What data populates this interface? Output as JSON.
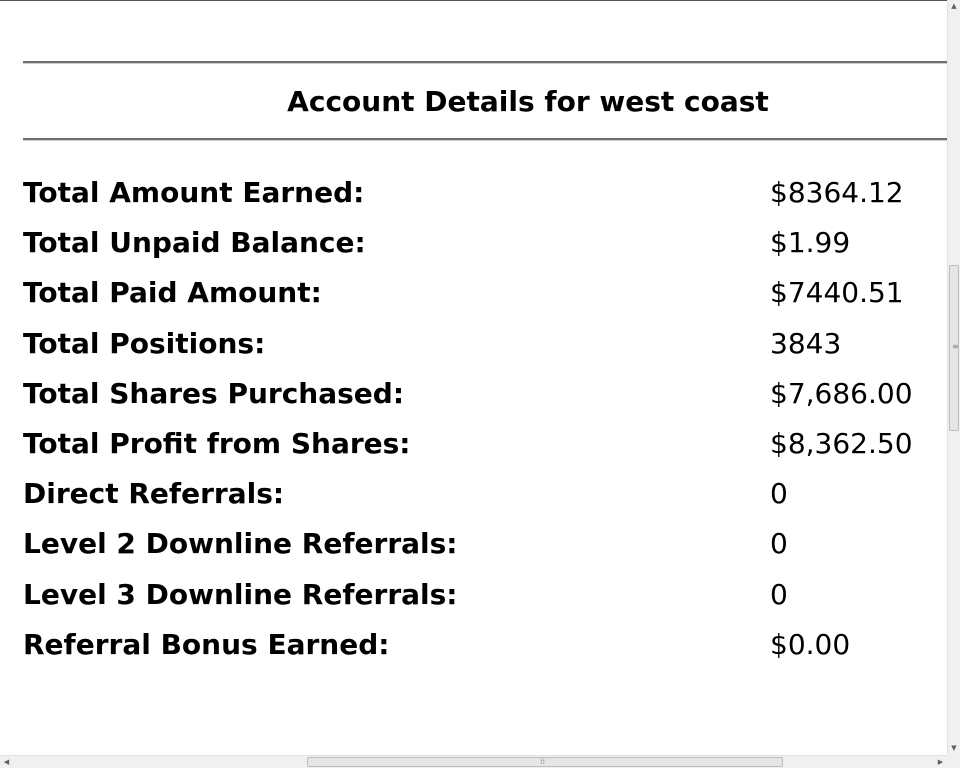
{
  "page": {
    "title": "Account Details for west coast"
  },
  "details": [
    {
      "label": "Total Amount Earned:",
      "value": "$8364.12"
    },
    {
      "label": "Total Unpaid Balance:",
      "value": "$1.99"
    },
    {
      "label": "Total Paid Amount:",
      "value": "$7440.51"
    },
    {
      "label": "Total Positions:",
      "value": "3843"
    },
    {
      "label": "Total Shares Purchased:",
      "value": "$7,686.00"
    },
    {
      "label": "Total Profit from Shares:",
      "value": "$8,362.50"
    },
    {
      "label": "Direct Referrals:",
      "value": "0"
    },
    {
      "label": "Level 2 Downline Referrals:",
      "value": "0"
    },
    {
      "label": "Level 3 Downline Referrals:",
      "value": "0"
    },
    {
      "label": "Referral Bonus Earned:",
      "value": "$0.00"
    }
  ],
  "scrollbars": {
    "vertical_position": 0.35,
    "horizontal_position": 0.5,
    "arrow_up_icon": "arrow-up-icon",
    "arrow_down_icon": "arrow-down-icon",
    "arrow_left_icon": "arrow-left-icon",
    "arrow_right_icon": "arrow-right-icon"
  }
}
